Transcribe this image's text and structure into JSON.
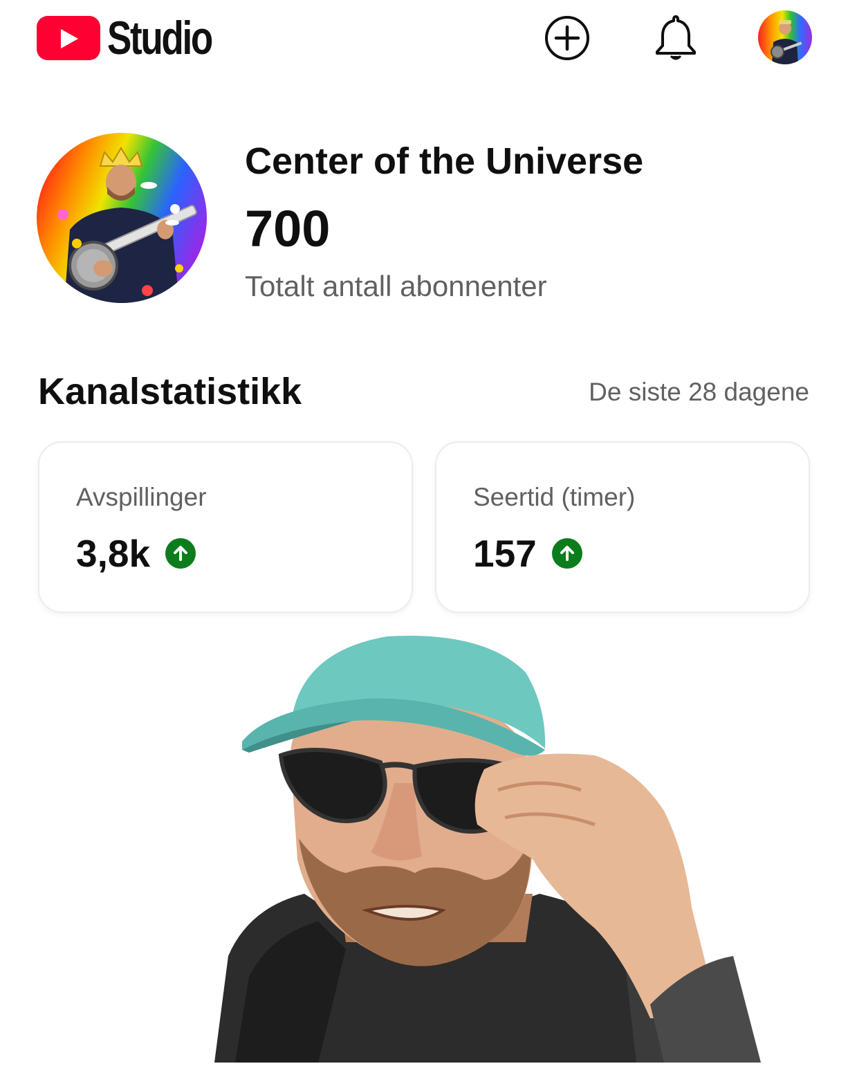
{
  "header": {
    "app_name": "Studio",
    "icons": {
      "logo": "youtube-play-icon",
      "create": "add-circle-icon",
      "notifications": "bell-icon",
      "account": "avatar-icon"
    },
    "brand_color": "#ff0033"
  },
  "channel": {
    "name": "Center of the Universe",
    "subscriber_count": "700",
    "subscriber_label": "Totalt antall abonnenter"
  },
  "stats": {
    "title": "Kanalstatistikk",
    "range": "De siste 28 dagene",
    "cards": [
      {
        "label": "Avspillinger",
        "value": "3,8k",
        "trend": "up"
      },
      {
        "label": "Seertid (timer)",
        "value": "157",
        "trend": "up"
      }
    ],
    "trend_color": "#0c7d1d"
  }
}
